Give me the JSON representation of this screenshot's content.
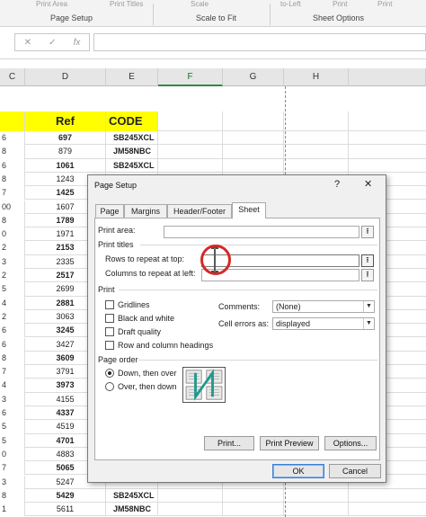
{
  "ribbon": {
    "groups": [
      "Page Setup",
      "Scale to Fit",
      "Sheet Options"
    ],
    "faded_top": [
      "Print Area",
      "Print Titles",
      "Scale",
      "to-Left",
      "Print",
      "Print"
    ]
  },
  "formula_bar": {
    "cancel_glyph": "✕",
    "enter_glyph": "✓",
    "function_glyph": "fx",
    "value": ""
  },
  "columns": [
    "C",
    "D",
    "E",
    "F",
    "G",
    "H"
  ],
  "sheet": {
    "header_row": {
      "ref": "Ref",
      "code": "CODE"
    },
    "rows": [
      {
        "rn": "6",
        "ref": "697",
        "code": "SB245XCL",
        "bold": true
      },
      {
        "rn": "8",
        "ref": "879",
        "code": "JM58NBC",
        "bold": false
      },
      {
        "rn": "6",
        "ref": "1061",
        "code": "SB245XCL",
        "bold": true
      },
      {
        "rn": "8",
        "ref": "1243",
        "code": "",
        "bold": false
      },
      {
        "rn": "7",
        "ref": "1425",
        "code": "",
        "bold": true
      },
      {
        "rn": "00",
        "ref": "1607",
        "code": "",
        "bold": false
      },
      {
        "rn": "8",
        "ref": "1789",
        "code": "",
        "bold": true
      },
      {
        "rn": "0",
        "ref": "1971",
        "code": "",
        "bold": false
      },
      {
        "rn": "2",
        "ref": "2153",
        "code": "",
        "bold": true
      },
      {
        "rn": "3",
        "ref": "2335",
        "code": "",
        "bold": false
      },
      {
        "rn": "2",
        "ref": "2517",
        "code": "",
        "bold": true
      },
      {
        "rn": "5",
        "ref": "2699",
        "code": "",
        "bold": false
      },
      {
        "rn": "4",
        "ref": "2881",
        "code": "",
        "bold": true
      },
      {
        "rn": "2",
        "ref": "3063",
        "code": "",
        "bold": false
      },
      {
        "rn": "6",
        "ref": "3245",
        "code": "",
        "bold": true
      },
      {
        "rn": "6",
        "ref": "3427",
        "code": "",
        "bold": false
      },
      {
        "rn": "8",
        "ref": "3609",
        "code": "",
        "bold": true
      },
      {
        "rn": "7",
        "ref": "3791",
        "code": "",
        "bold": false
      },
      {
        "rn": "4",
        "ref": "3973",
        "code": "",
        "bold": true
      },
      {
        "rn": "3",
        "ref": "4155",
        "code": "",
        "bold": false
      },
      {
        "rn": "6",
        "ref": "4337",
        "code": "",
        "bold": true
      },
      {
        "rn": "5",
        "ref": "4519",
        "code": "",
        "bold": false
      },
      {
        "rn": "5",
        "ref": "4701",
        "code": "",
        "bold": true
      },
      {
        "rn": "0",
        "ref": "4883",
        "code": "",
        "bold": false
      },
      {
        "rn": "7",
        "ref": "5065",
        "code": "",
        "bold": true
      },
      {
        "rn": "3",
        "ref": "5247",
        "code": "",
        "bold": false
      },
      {
        "rn": "8",
        "ref": "5429",
        "code": "SB245XCL",
        "bold": true
      },
      {
        "rn": "1",
        "ref": "5611",
        "code": "JM58NBC",
        "bold": false
      }
    ]
  },
  "dialog": {
    "title": "Page Setup",
    "help_glyph": "?",
    "close_glyph": "✕",
    "tabs": [
      "Page",
      "Margins",
      "Header/Footer",
      "Sheet"
    ],
    "active_tab": "Sheet",
    "print_area_label": "Print area:",
    "print_titles_label": "Print titles",
    "rows_repeat_label": "Rows to repeat at top:",
    "cols_repeat_label": "Columns to repeat at left:",
    "picker_glyph": "⭱",
    "print_section_label": "Print",
    "checkboxes": [
      "Gridlines",
      "Black and white",
      "Draft quality",
      "Row and column headings"
    ],
    "comments_label": "Comments:",
    "comments_value": "(None)",
    "cell_errors_label": "Cell errors as:",
    "cell_errors_value": "displayed",
    "page_order_label": "Page order",
    "order_down": "Down, then over",
    "order_over": "Over, then down",
    "buttons": {
      "print": "Print...",
      "preview": "Print Preview",
      "options": "Options...",
      "ok": "OK",
      "cancel": "Cancel"
    }
  }
}
